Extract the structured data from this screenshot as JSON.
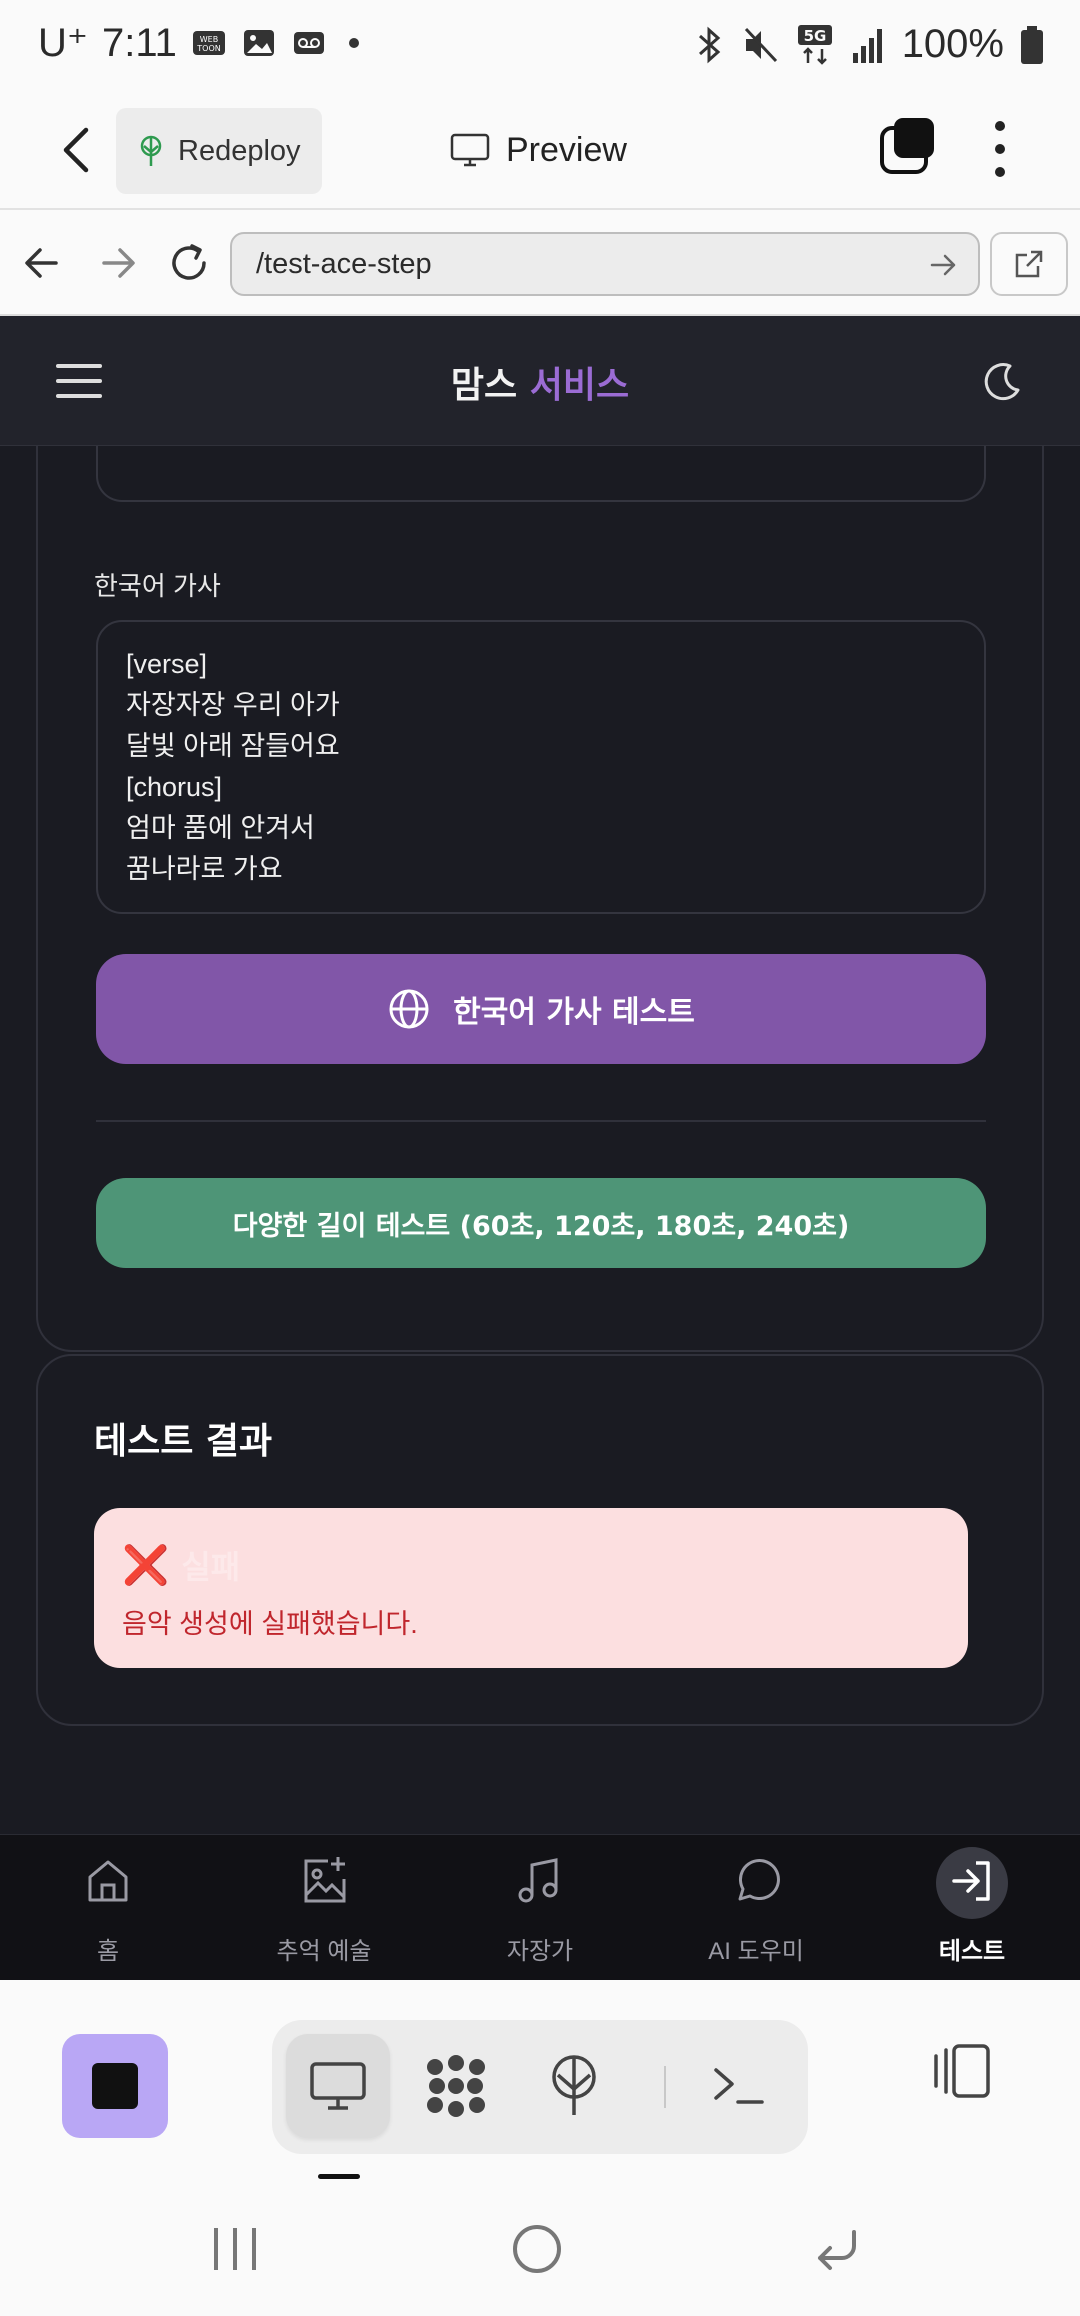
{
  "status_bar": {
    "carrier": "U⁺",
    "time": "7:11",
    "battery": "100%"
  },
  "app_bar": {
    "redeploy_label": "Redeploy",
    "preview_label": "Preview"
  },
  "url_bar": {
    "url": "/test-ace-step"
  },
  "site_header": {
    "brand_part1": "맘스",
    "brand_part2": "서비스"
  },
  "form": {
    "lyrics_label": "한국어 가사",
    "lyrics_text": "[verse]\n자장자장 우리 아가\n달빛 아래 잠들어요\n[chorus]\n엄마 품에 안겨서\n꿈나라로 가요",
    "korean_test_button": "한국어 가사 테스트",
    "length_test_button": "다양한 길이 테스트 (60초, 120초, 180초, 240초)"
  },
  "results": {
    "title": "테스트 결과",
    "status_icon": "❌",
    "status_label": "실패",
    "message": "음악 생성에 실패했습니다."
  },
  "bottom_nav": {
    "items": [
      {
        "label": "홈",
        "icon": "home-icon"
      },
      {
        "label": "추억 예술",
        "icon": "image-plus-icon"
      },
      {
        "label": "자장가",
        "icon": "music-note-icon"
      },
      {
        "label": "AI 도우미",
        "icon": "chat-bubble-icon"
      },
      {
        "label": "테스트",
        "icon": "log-in-icon",
        "active": true
      }
    ]
  },
  "colors": {
    "accent_purple": "#8156a8",
    "accent_green": "#4e9577",
    "error_bg": "#fcdfe0",
    "error_text": "#c0262d"
  }
}
